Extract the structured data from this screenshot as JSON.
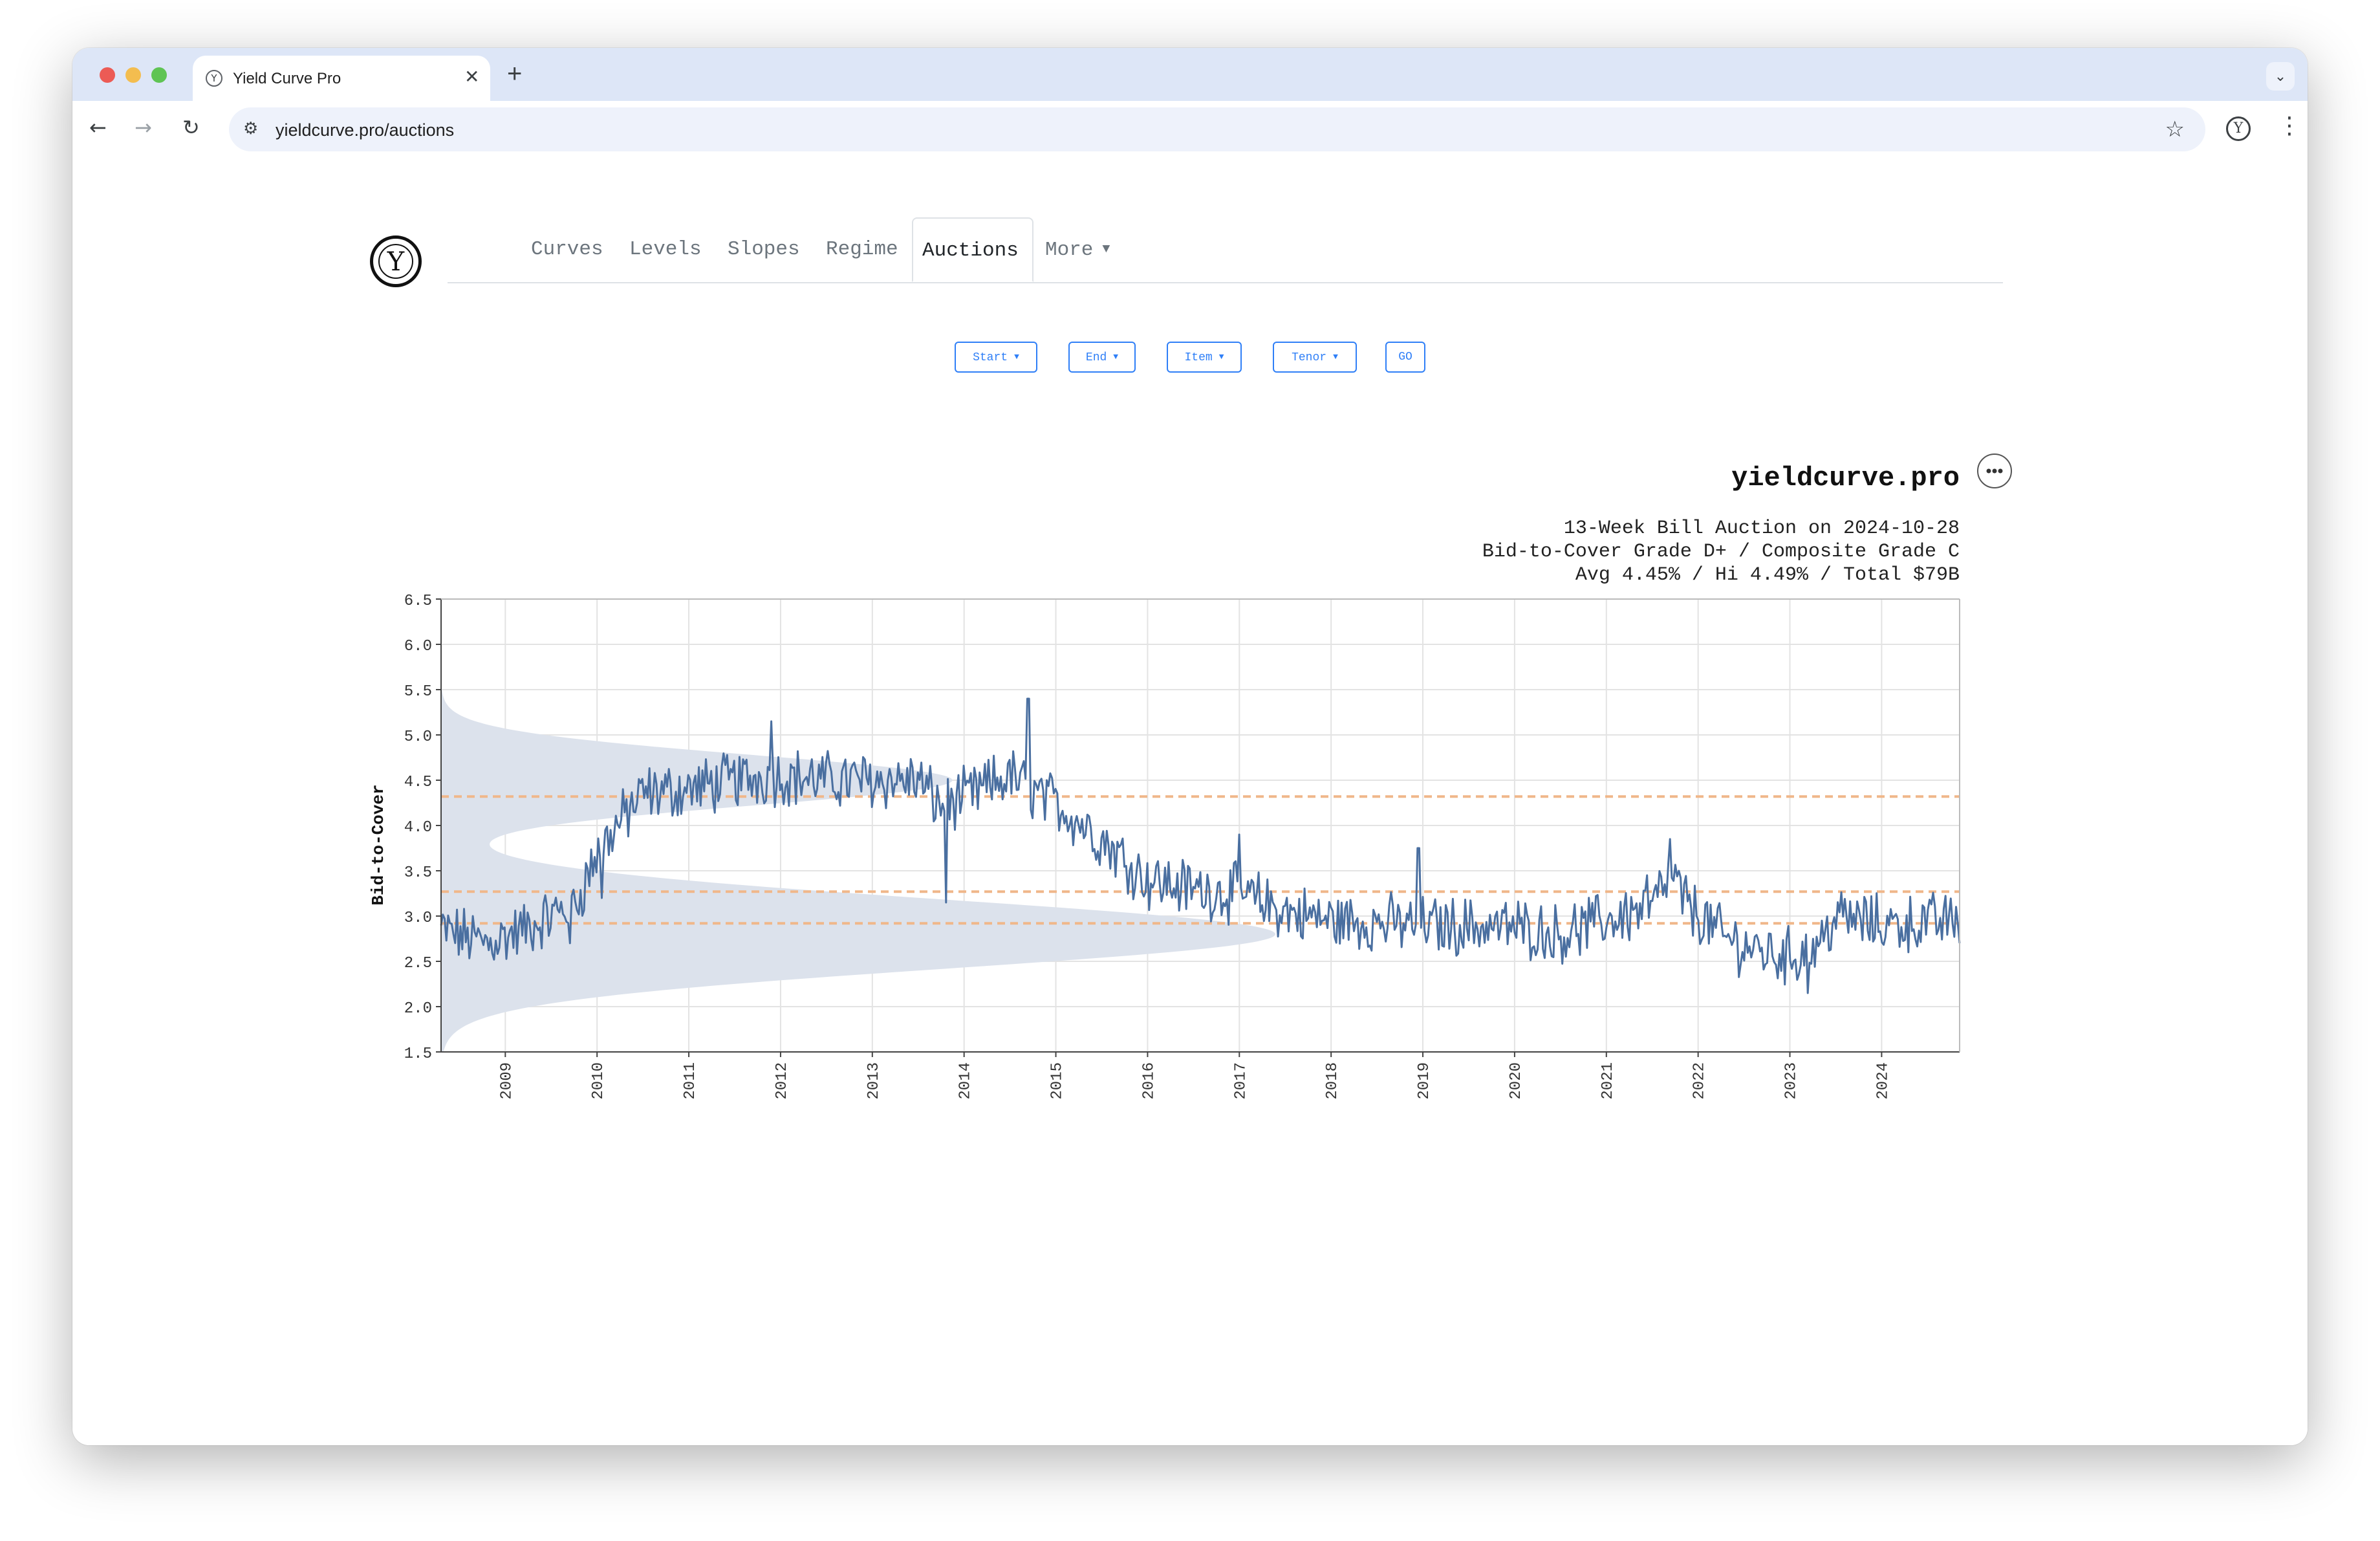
{
  "browser": {
    "tab_title": "Yield Curve Pro",
    "url": "yieldcurve.pro/auctions"
  },
  "nav": {
    "tabs": [
      "Curves",
      "Levels",
      "Slopes",
      "Regime",
      "Auctions",
      "More"
    ],
    "active": "Auctions"
  },
  "filters": [
    "Start",
    "End",
    "Item",
    "Tenor"
  ],
  "go_label": "GO",
  "chart_data": {
    "type": "line",
    "brand": "yieldcurve.pro",
    "info_lines": [
      "13-Week Bill Auction on 2024-10-28",
      "Bid-to-Cover Grade D+ / Composite Grade C",
      "Avg 4.45% / Hi 4.49% / Total $79B"
    ],
    "ylabel": "Bid-to-Cover",
    "ylim": [
      1.5,
      6.5
    ],
    "yticks": [
      "1.5",
      "2.0",
      "2.5",
      "3.0",
      "3.5",
      "4.0",
      "4.5",
      "5.0",
      "5.5",
      "6.0",
      "6.5"
    ],
    "xlim": [
      2008.3,
      2024.85
    ],
    "xticks": [
      "2009",
      "2010",
      "2011",
      "2012",
      "2013",
      "2014",
      "2015",
      "2016",
      "2017",
      "2018",
      "2019",
      "2020",
      "2021",
      "2022",
      "2023",
      "2024"
    ],
    "reference_lines": [
      4.32,
      3.27,
      2.92
    ],
    "distribution_modes": [
      {
        "center": 2.8,
        "sigma": 0.38,
        "weight": 0.62
      },
      {
        "center": 4.5,
        "sigma": 0.28,
        "weight": 0.38
      }
    ],
    "series": [
      {
        "name": "",
        "anchors": [
          [
            2008.3,
            2.85
          ],
          [
            2008.8,
            2.7
          ],
          [
            2009.2,
            2.85
          ],
          [
            2009.5,
            3.0
          ],
          [
            2009.8,
            3.2
          ],
          [
            2010.0,
            3.7
          ],
          [
            2010.3,
            4.1
          ],
          [
            2010.5,
            4.35
          ],
          [
            2011.0,
            4.4
          ],
          [
            2011.5,
            4.5
          ],
          [
            2012.0,
            4.55
          ],
          [
            2012.5,
            4.5
          ],
          [
            2013.0,
            4.5
          ],
          [
            2013.5,
            4.5
          ],
          [
            2013.75,
            4.2
          ],
          [
            2014.0,
            4.3
          ],
          [
            2014.5,
            4.55
          ],
          [
            2014.8,
            4.35
          ],
          [
            2015.0,
            4.25
          ],
          [
            2015.5,
            3.85
          ],
          [
            2016.0,
            3.4
          ],
          [
            2016.5,
            3.3
          ],
          [
            2017.0,
            3.25
          ],
          [
            2017.5,
            3.05
          ],
          [
            2018.0,
            2.95
          ],
          [
            2019.0,
            2.9
          ],
          [
            2020.0,
            2.88
          ],
          [
            2020.5,
            2.8
          ],
          [
            2021.0,
            2.95
          ],
          [
            2021.5,
            3.1
          ],
          [
            2021.7,
            3.45
          ],
          [
            2021.9,
            3.1
          ],
          [
            2022.3,
            2.75
          ],
          [
            2022.7,
            2.6
          ],
          [
            2023.0,
            2.55
          ],
          [
            2023.3,
            2.65
          ],
          [
            2023.5,
            3.0
          ],
          [
            2024.0,
            2.9
          ],
          [
            2024.85,
            2.95
          ]
        ],
        "spikes": [
          [
            2009.7,
            2.7
          ],
          [
            2010.05,
            3.2
          ],
          [
            2011.9,
            5.15
          ],
          [
            2013.8,
            3.15
          ],
          [
            2014.7,
            5.4
          ],
          [
            2014.9,
            4.5
          ],
          [
            2017.0,
            3.9
          ],
          [
            2018.95,
            3.75
          ],
          [
            2021.45,
            3.45
          ],
          [
            2021.7,
            3.85
          ],
          [
            2023.2,
            2.15
          ]
        ]
      }
    ]
  }
}
